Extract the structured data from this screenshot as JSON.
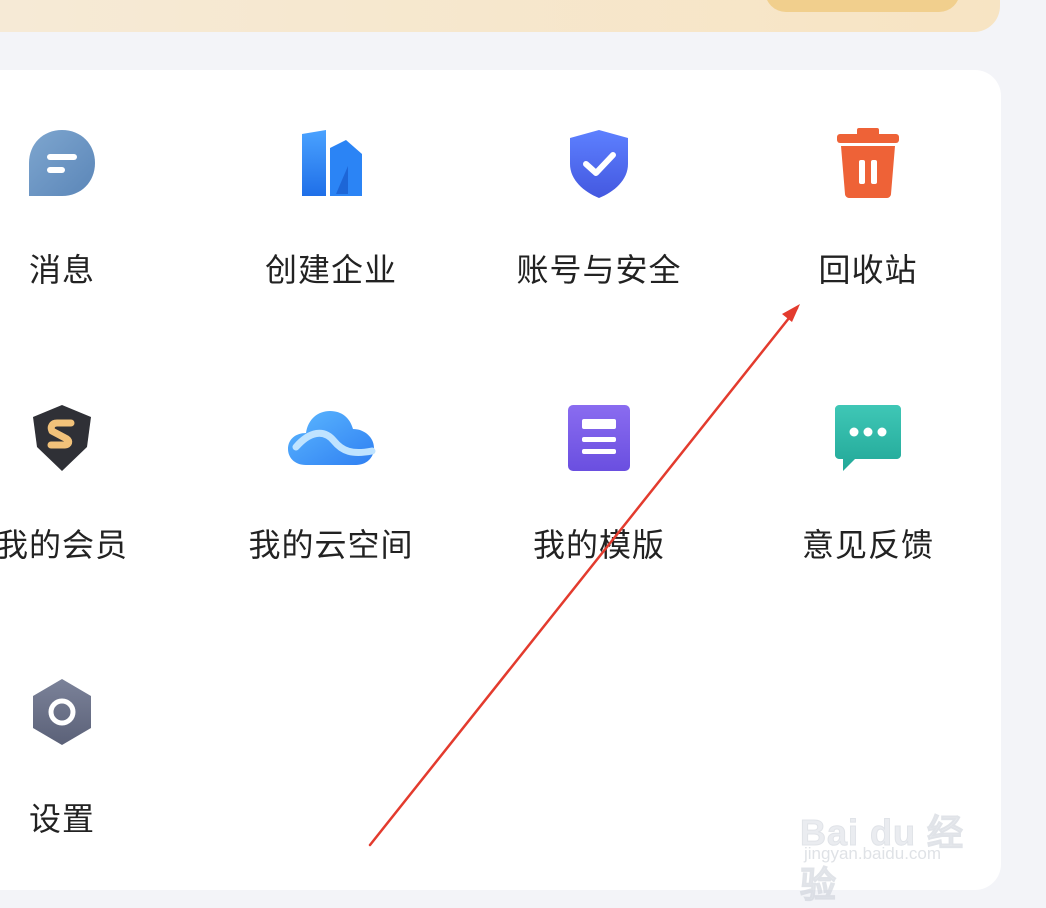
{
  "grid": {
    "items": [
      {
        "label": "消息",
        "icon": "message-icon"
      },
      {
        "label": "创建企业",
        "icon": "enterprise-icon"
      },
      {
        "label": "账号与安全",
        "icon": "shield-check-icon"
      },
      {
        "label": "回收站",
        "icon": "trash-icon"
      },
      {
        "label": "我的会员",
        "icon": "vip-badge-icon"
      },
      {
        "label": "我的云空间",
        "icon": "cloud-icon"
      },
      {
        "label": "我的模版",
        "icon": "template-icon"
      },
      {
        "label": "意见反馈",
        "icon": "feedback-icon"
      },
      {
        "label": "设置",
        "icon": "settings-icon"
      }
    ]
  },
  "watermark": {
    "logo": "Bai du 经验",
    "url": "jingyan.baidu.com"
  },
  "colors": {
    "accent_orange": "#ee6237",
    "annotation_red": "#e33b2e",
    "shield_blue": "#4e6cf2"
  }
}
